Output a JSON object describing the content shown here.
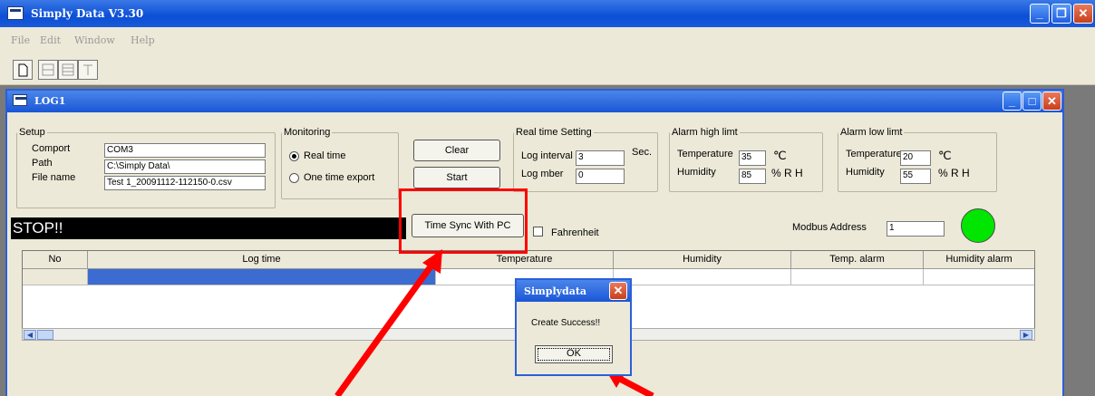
{
  "app": {
    "title": "Simply Data V3.30"
  },
  "menu": [
    "File",
    "Edit",
    "Window",
    "Help"
  ],
  "child": {
    "title": "LOG1"
  },
  "setup": {
    "legend": "Setup",
    "comport_label": "Comport",
    "comport_value": "COM3",
    "path_label": "Path",
    "path_value": "C:\\Simply Data\\",
    "filename_label": "File name",
    "filename_value": "Test 1_20091112-112150-0.csv"
  },
  "monitoring": {
    "legend": "Monitoring",
    "real_time": "Real time",
    "one_time": "One time export",
    "selected": "Real time"
  },
  "buttons": {
    "clear": "Clear",
    "start": "Start",
    "time_sync": "Time Sync With PC",
    "ok": "OK"
  },
  "realtime": {
    "legend": "Real time Setting",
    "interval_label": "Log interval",
    "interval_value": "3",
    "sec_label": "Sec.",
    "number_label": "Log mber",
    "number_value": "0"
  },
  "alarm_high": {
    "legend": "Alarm high limt",
    "temp_label": "Temperature",
    "temp_value": "35",
    "temp_unit": "℃",
    "hum_label": "Humidity",
    "hum_value": "85",
    "hum_unit": "% R H"
  },
  "alarm_low": {
    "legend": "Alarm low limt",
    "temp_label": "Temperature",
    "temp_value": "20",
    "temp_unit": "℃",
    "hum_label": "Humidity",
    "hum_value": "55",
    "hum_unit": "% R H"
  },
  "status": {
    "text": "STOP!!"
  },
  "fahrenheit": {
    "label": "Fahrenheit",
    "checked": false
  },
  "modbus": {
    "label": "Modbus Address",
    "value": "1"
  },
  "table": {
    "headers": [
      "No",
      "Log time",
      "Temperature",
      "Humidity",
      "Temp. alarm",
      "Humidity alarm"
    ]
  },
  "dialog": {
    "title": "Simplydata",
    "message": "Create Success!!"
  },
  "colors": {
    "titlebar": "#0b4fd6",
    "status_led": "#00e600",
    "highlight": "#ff0000"
  },
  "icons": [
    "app-icon",
    "minimize-icon",
    "maximize-icon",
    "close-icon",
    "new-file-icon",
    "tile-icon",
    "cascade-icon",
    "text-icon",
    "scroll-left-icon",
    "scroll-right-icon",
    "arrow-icon"
  ]
}
